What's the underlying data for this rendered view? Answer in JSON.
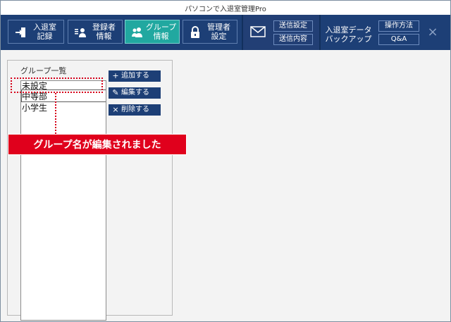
{
  "window": {
    "title": "パソコンで入退室管理Pro"
  },
  "toolbar": {
    "entry_record": "入退室\n記録",
    "registrant_info": "登録者\n情報",
    "group_info": "グループ\n情報",
    "admin_settings": "管理者\n設定",
    "send_settings": "送信設定",
    "send_content": "送信内容",
    "backup": "入退室データ\nバックアップ",
    "how_to": "操作方法",
    "qa": "Q&A"
  },
  "group_panel": {
    "title": "グループ一覧",
    "items": [
      "未設定",
      "中等部",
      "小学生"
    ],
    "selected_index": 1
  },
  "actions": {
    "add": "追加する",
    "edit": "編集する",
    "delete": "削除する"
  },
  "callout": {
    "text": "グループ名が編集されました"
  },
  "colors": {
    "toolbar_bg": "#1d3f76",
    "active_tab": "#21a8a0",
    "callout_red": "#e0001c"
  },
  "icons": {
    "entry": "door-exit-icon",
    "registrant": "person-card-icon",
    "group": "group-icon",
    "admin": "lock-icon",
    "mail": "mail-icon",
    "close": "close-icon"
  }
}
